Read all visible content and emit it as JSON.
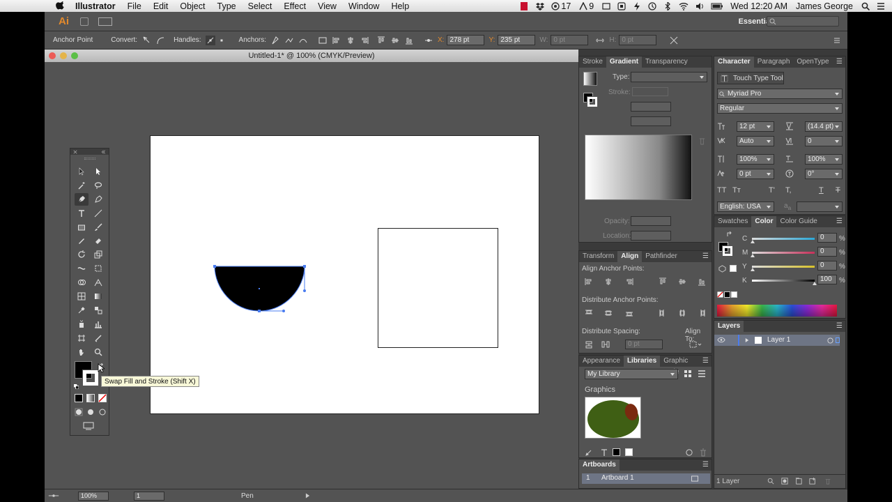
{
  "menubar": {
    "app_name": "Illustrator",
    "menus": [
      "File",
      "Edit",
      "Object",
      "Type",
      "Select",
      "Effect",
      "View",
      "Window",
      "Help"
    ],
    "battery_count": "17",
    "ai_count": "9",
    "clock": "Wed 12:20 AM",
    "user": "James George"
  },
  "appbar": {
    "logo": "Ai",
    "workspace": "Essentials"
  },
  "control": {
    "tool_label": "Anchor Point",
    "convert_label": "Convert:",
    "handles_label": "Handles:",
    "anchors_label": "Anchors:",
    "x_label": "X:",
    "x_value": "278 pt",
    "y_label": "Y:",
    "y_value": "235 pt",
    "w_label": "W:",
    "w_value": "0 pt",
    "h_label": "H:",
    "h_value": "0 pt"
  },
  "document": {
    "title": "Untitled-1* @ 100% (CMYK/Preview)"
  },
  "tooltip": "Swap Fill and Stroke (Shift X)",
  "status": {
    "zoom": "100%",
    "artboard": "1",
    "tool": "Pen"
  },
  "gradient_panel": {
    "tabs": [
      "Stroke",
      "Gradient",
      "Transparency"
    ],
    "type_label": "Type:",
    "stroke_label": "Stroke:",
    "opacity_label": "Opacity:",
    "location_label": "Location:"
  },
  "character_panel": {
    "tabs": [
      "Character",
      "Paragraph",
      "OpenType"
    ],
    "touch_type": "Touch Type Tool",
    "font": "Myriad Pro",
    "style": "Regular",
    "size": "12 pt",
    "leading": "(14.4 pt)",
    "kerning": "Auto",
    "tracking": "0",
    "vscale": "100%",
    "hscale": "100%",
    "baseline": "0 pt",
    "rotation": "0°",
    "language": "English: USA",
    "aa_label": "a",
    "aa_mode": "a"
  },
  "color_panel": {
    "tabs": [
      "Swatches",
      "Color",
      "Color Guide"
    ],
    "c_label": "C",
    "m_label": "M",
    "y_label": "Y",
    "k_label": "K",
    "c": "0",
    "m": "0",
    "y": "0",
    "k": "100",
    "pct": "%",
    "k_level": 1.0
  },
  "align_panel": {
    "tabs": [
      "Transform",
      "Align",
      "Pathfinder"
    ],
    "align_anchor": "Align Anchor Points:",
    "distribute_anchor": "Distribute Anchor Points:",
    "distribute_spacing": "Distribute Spacing:",
    "align_to": "Align To:",
    "spacing_value": "0 pt"
  },
  "layers_panel": {
    "title": "Layers",
    "layer_name": "Layer 1",
    "count": "1 Layer"
  },
  "libraries_panel": {
    "tabs": [
      "Appearance",
      "Libraries",
      "Graphic Style"
    ],
    "library": "My Library",
    "graphics_label": "Graphics"
  },
  "artboards_panel": {
    "title": "Artboards",
    "number": "1",
    "name": "Artboard 1"
  },
  "colors": {
    "accent": "#e38a2d",
    "panel_bg": "#535353",
    "selection": "#4a7cf0"
  }
}
